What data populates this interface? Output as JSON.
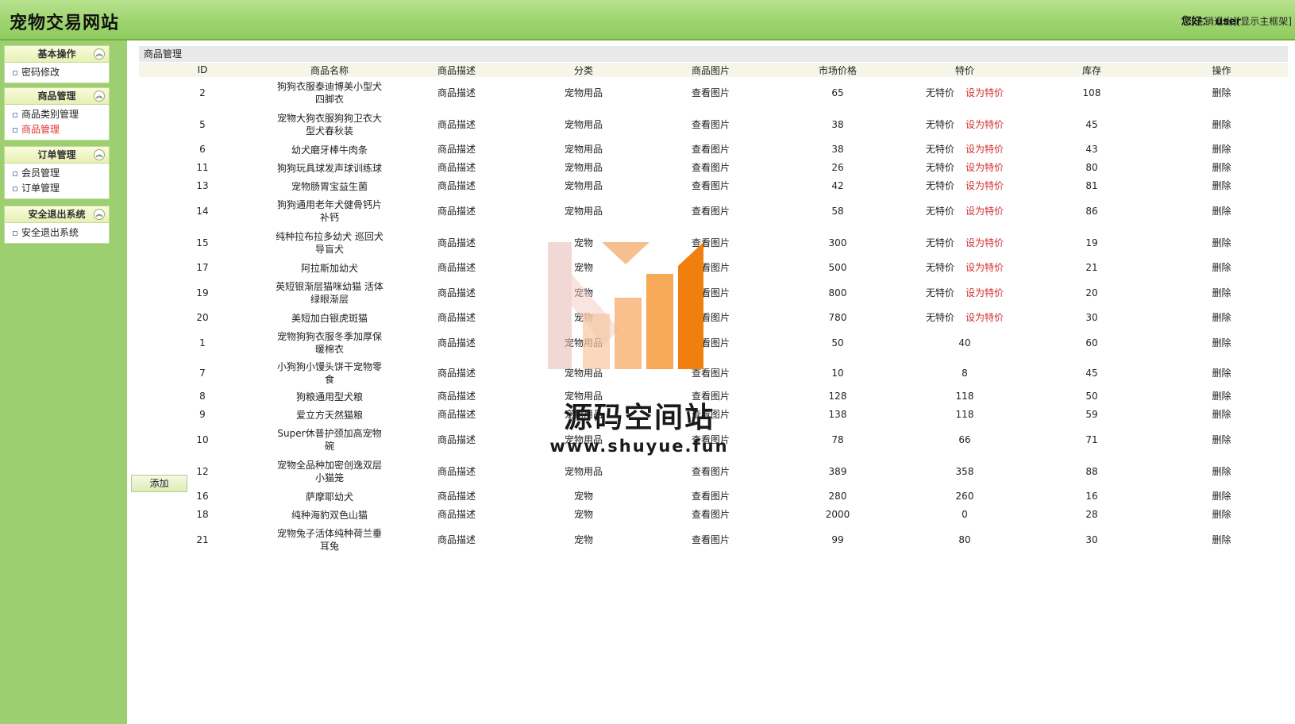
{
  "header": {
    "site_title": "宠物交易网站",
    "greeting": "您好：",
    "username": "user",
    "logout_link": "[注销退出]",
    "show_frame_link": "[显示主框架]"
  },
  "sidebar": {
    "groups": [
      {
        "title": "基本操作",
        "items": [
          {
            "label": "密码修改"
          }
        ]
      },
      {
        "title": "商品管理",
        "items": [
          {
            "label": "商品类别管理"
          },
          {
            "label": "商品管理"
          }
        ]
      },
      {
        "title": "订单管理",
        "items": [
          {
            "label": "会员管理"
          },
          {
            "label": "订单管理"
          }
        ]
      },
      {
        "title": "安全退出系统",
        "items": [
          {
            "label": "安全退出系统"
          }
        ]
      }
    ],
    "active_item": "商品管理"
  },
  "main": {
    "panel_title": "商品管理",
    "columns": [
      "ID",
      "商品名称",
      "商品描述",
      "分类",
      "商品图片",
      "市场价格",
      "特价",
      "库存",
      "操作"
    ],
    "rows": [
      {
        "id": "2",
        "name": "狗狗衣服泰迪博美小型犬四脚衣",
        "desc": "商品描述",
        "category": "宠物用品",
        "image": "查看图片",
        "market_price": "65",
        "special": "无特价",
        "set_special": "设为特价",
        "stock": "108",
        "action": "删除"
      },
      {
        "id": "5",
        "name": "宠物大狗衣服狗狗卫衣大型犬春秋装",
        "desc": "商品描述",
        "category": "宠物用品",
        "image": "查看图片",
        "market_price": "38",
        "special": "无特价",
        "set_special": "设为特价",
        "stock": "45",
        "action": "删除"
      },
      {
        "id": "6",
        "name": "幼犬磨牙棒牛肉条",
        "desc": "商品描述",
        "category": "宠物用品",
        "image": "查看图片",
        "market_price": "38",
        "special": "无特价",
        "set_special": "设为特价",
        "stock": "43",
        "action": "删除"
      },
      {
        "id": "11",
        "name": "狗狗玩具球发声球训练球",
        "desc": "商品描述",
        "category": "宠物用品",
        "image": "查看图片",
        "market_price": "26",
        "special": "无特价",
        "set_special": "设为特价",
        "stock": "80",
        "action": "删除"
      },
      {
        "id": "13",
        "name": "宠物肠胃宝益生菌",
        "desc": "商品描述",
        "category": "宠物用品",
        "image": "查看图片",
        "market_price": "42",
        "special": "无特价",
        "set_special": "设为特价",
        "stock": "81",
        "action": "删除"
      },
      {
        "id": "14",
        "name": "狗狗通用老年犬健骨钙片补钙",
        "desc": "商品描述",
        "category": "宠物用品",
        "image": "查看图片",
        "market_price": "58",
        "special": "无特价",
        "set_special": "设为特价",
        "stock": "86",
        "action": "删除"
      },
      {
        "id": "15",
        "name": "纯种拉布拉多幼犬 巡回犬 导盲犬",
        "desc": "商品描述",
        "category": "宠物",
        "image": "查看图片",
        "market_price": "300",
        "special": "无特价",
        "set_special": "设为特价",
        "stock": "19",
        "action": "删除"
      },
      {
        "id": "17",
        "name": "阿拉斯加幼犬",
        "desc": "商品描述",
        "category": "宠物",
        "image": "查看图片",
        "market_price": "500",
        "special": "无特价",
        "set_special": "设为特价",
        "stock": "21",
        "action": "删除"
      },
      {
        "id": "19",
        "name": "英短银渐层猫咪幼猫 活体绿眼渐层",
        "desc": "商品描述",
        "category": "宠物",
        "image": "查看图片",
        "market_price": "800",
        "special": "无特价",
        "set_special": "设为特价",
        "stock": "20",
        "action": "删除"
      },
      {
        "id": "20",
        "name": "美短加白银虎斑猫",
        "desc": "商品描述",
        "category": "宠物",
        "image": "查看图片",
        "market_price": "780",
        "special": "无特价",
        "set_special": "设为特价",
        "stock": "30",
        "action": "删除"
      },
      {
        "id": "1",
        "name": "宠物狗狗衣服冬季加厚保暖棉衣",
        "desc": "商品描述",
        "category": "宠物用品",
        "image": "查看图片",
        "market_price": "50",
        "special": "40",
        "set_special": "",
        "stock": "60",
        "action": "删除"
      },
      {
        "id": "7",
        "name": "小狗狗小馒头饼干宠物零食",
        "desc": "商品描述",
        "category": "宠物用品",
        "image": "查看图片",
        "market_price": "10",
        "special": "8",
        "set_special": "",
        "stock": "45",
        "action": "删除"
      },
      {
        "id": "8",
        "name": "狗粮通用型犬粮",
        "desc": "商品描述",
        "category": "宠物用品",
        "image": "查看图片",
        "market_price": "128",
        "special": "118",
        "set_special": "",
        "stock": "50",
        "action": "删除"
      },
      {
        "id": "9",
        "name": "爱立方天然猫粮",
        "desc": "商品描述",
        "category": "宠物用品",
        "image": "查看图片",
        "market_price": "138",
        "special": "118",
        "set_special": "",
        "stock": "59",
        "action": "删除"
      },
      {
        "id": "10",
        "name": "Super休普护颈加高宠物碗",
        "desc": "商品描述",
        "category": "宠物用品",
        "image": "查看图片",
        "market_price": "78",
        "special": "66",
        "set_special": "",
        "stock": "71",
        "action": "删除"
      },
      {
        "id": "12",
        "name": "宠物全品种加密创逸双层小猫笼",
        "desc": "商品描述",
        "category": "宠物用品",
        "image": "查看图片",
        "market_price": "389",
        "special": "358",
        "set_special": "",
        "stock": "88",
        "action": "删除"
      },
      {
        "id": "16",
        "name": "萨摩耶幼犬",
        "desc": "商品描述",
        "category": "宠物",
        "image": "查看图片",
        "market_price": "280",
        "special": "260",
        "set_special": "",
        "stock": "16",
        "action": "删除"
      },
      {
        "id": "18",
        "name": "纯种海豹双色山猫",
        "desc": "商品描述",
        "category": "宠物",
        "image": "查看图片",
        "market_price": "2000",
        "special": "0",
        "set_special": "",
        "stock": "28",
        "action": "删除"
      },
      {
        "id": "21",
        "name": "宠物兔子活体纯种荷兰垂耳兔",
        "desc": "商品描述",
        "category": "宠物",
        "image": "查看图片",
        "market_price": "99",
        "special": "80",
        "set_special": "",
        "stock": "30",
        "action": "删除"
      }
    ],
    "add_button": "添加"
  },
  "watermark": {
    "text": "源码空间站",
    "url": "www.shuyue.fun"
  }
}
